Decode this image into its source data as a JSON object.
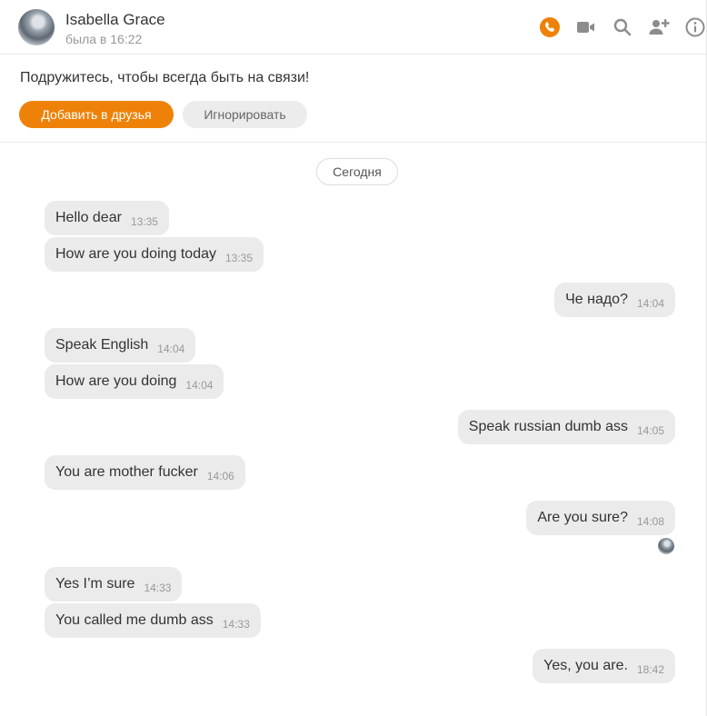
{
  "header": {
    "name": "Isabella Grace",
    "status": "была в 16:22",
    "icons": [
      "phone-icon",
      "video-camera-icon",
      "search-icon",
      "add-user-icon",
      "info-icon"
    ],
    "accent_color": "#ee8208",
    "icon_color": "#8c8c8c"
  },
  "friend_bar": {
    "text": "Подружитесь, чтобы всегда быть на связи!",
    "add_label": "Добавить в друзья",
    "ignore_label": "Игнорировать"
  },
  "chat": {
    "date_label": "Сегодня",
    "messages": [
      {
        "dir": "in",
        "text": "Hello dear",
        "time": "13:35"
      },
      {
        "dir": "in",
        "text": "How are you doing today",
        "time": "13:35"
      },
      {
        "dir": "out",
        "text": "Че надо?",
        "time": "14:04"
      },
      {
        "dir": "in",
        "text": "Speak English",
        "time": "14:04"
      },
      {
        "dir": "in",
        "text": "How are you doing",
        "time": "14:04"
      },
      {
        "dir": "out",
        "text": "Speak russian dumb ass",
        "time": "14:05"
      },
      {
        "dir": "in",
        "text": "You are mother fucker",
        "time": "14:06"
      },
      {
        "dir": "out",
        "text": "Are you sure?",
        "time": "14:08"
      },
      {
        "dir": "in",
        "text": "Yes I’m sure",
        "time": "14:33"
      },
      {
        "dir": "in",
        "text": "You called me dumb ass",
        "time": "14:33"
      },
      {
        "dir": "out",
        "text": "Yes, you are.",
        "time": "18:42"
      }
    ]
  }
}
